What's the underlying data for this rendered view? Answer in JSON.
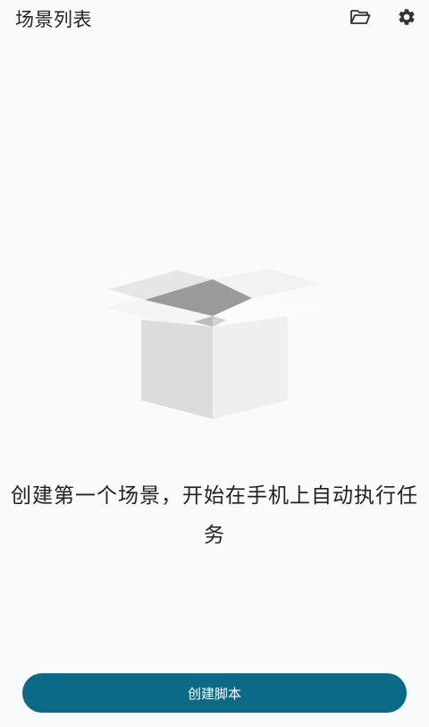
{
  "header": {
    "title": "场景列表",
    "icons": [
      "folder-open-icon",
      "gear-icon"
    ]
  },
  "empty_state": {
    "illustration": "open-box-icon",
    "message": "创建第一个场景，开始在手机上自动执行任务"
  },
  "actions": {
    "create_script_label": "创建脚本"
  },
  "colors": {
    "background": "#f9fafc",
    "primary": "#0c6a89",
    "text": "#222222"
  }
}
